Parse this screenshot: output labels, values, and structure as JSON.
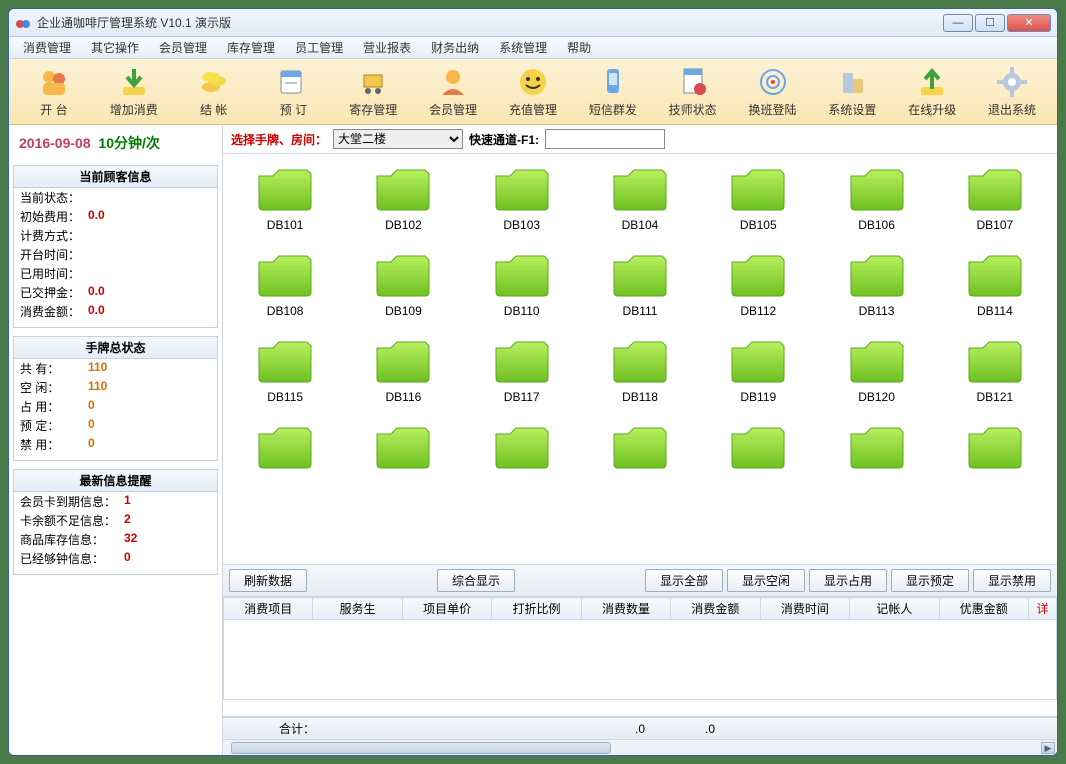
{
  "title": "企业通咖啡厅管理系统 V10.1  演示版",
  "menu": [
    "消费管理",
    "其它操作",
    "会员管理",
    "库存管理",
    "员工管理",
    "营业报表",
    "财务出纳",
    "系统管理",
    "帮助"
  ],
  "toolbar": [
    {
      "label": "开  台",
      "icon": "people"
    },
    {
      "label": "增加消费",
      "icon": "down"
    },
    {
      "label": "结  帐",
      "icon": "coins"
    },
    {
      "label": "预  订",
      "icon": "cal"
    },
    {
      "label": "寄存管理",
      "icon": "cart"
    },
    {
      "label": "会员管理",
      "icon": "member"
    },
    {
      "label": "充值管理",
      "icon": "smile"
    },
    {
      "label": "短信群发",
      "icon": "phone"
    },
    {
      "label": "技师状态",
      "icon": "doc"
    },
    {
      "label": "换班登陆",
      "icon": "target"
    },
    {
      "label": "系统设置",
      "icon": "build"
    },
    {
      "label": "在线升级",
      "icon": "up"
    },
    {
      "label": "退出系统",
      "icon": "gear"
    }
  ],
  "date": "2016-09-08",
  "rate": "10分钟/次",
  "filter": {
    "label": "选择手牌、房间：",
    "room": "大堂二楼",
    "fast_label": "快速通道-F1:",
    "fast_value": ""
  },
  "customer_panel": {
    "title": "当前顾客信息",
    "rows": [
      {
        "k": "当前状态：",
        "v": ""
      },
      {
        "k": "初始费用：",
        "v": "0.0",
        "cls": "vred"
      },
      {
        "k": "计费方式：",
        "v": ""
      },
      {
        "k": "开台时间：",
        "v": ""
      },
      {
        "k": "已用时间：",
        "v": ""
      },
      {
        "k": "已交押金：",
        "v": "0.0",
        "cls": "vred"
      },
      {
        "k": "消费金额：",
        "v": "0.0",
        "cls": "vred"
      }
    ]
  },
  "status_panel": {
    "title": "手牌总状态",
    "rows": [
      {
        "k": "共    有：",
        "v": "110",
        "cls": "vorange"
      },
      {
        "k": "空    闲：",
        "v": "110",
        "cls": "vorange"
      },
      {
        "k": "占    用：",
        "v": "0",
        "cls": "vorange"
      },
      {
        "k": "预    定：",
        "v": "0",
        "cls": "vorange"
      },
      {
        "k": "禁    用：",
        "v": "0",
        "cls": "vorange"
      }
    ]
  },
  "alert_panel": {
    "title": "最新信息提醒",
    "rows": [
      {
        "k": "会员卡到期信息：",
        "v": "1",
        "cls": "vred"
      },
      {
        "k": "卡余额不足信息：",
        "v": "2",
        "cls": "vred"
      },
      {
        "k": "商品库存信息：",
        "v": "32",
        "cls": "vred"
      },
      {
        "k": "已经够钟信息：",
        "v": "0",
        "cls": "vred"
      }
    ]
  },
  "folders": [
    "DB101",
    "DB102",
    "DB103",
    "DB104",
    "DB105",
    "DB106",
    "DB107",
    "DB108",
    "DB109",
    "DB110",
    "DB111",
    "DB112",
    "DB113",
    "DB114",
    "DB115",
    "DB116",
    "DB117",
    "DB118",
    "DB119",
    "DB120",
    "DB121",
    "",
    "",
    "",
    "",
    "",
    "",
    ""
  ],
  "action_buttons": [
    "刷新数据",
    "综合显示",
    "显示全部",
    "显示空闲",
    "显示占用",
    "显示预定",
    "显示禁用"
  ],
  "table_headers": [
    "消费项目",
    "服务生",
    "项目单价",
    "打折比例",
    "消费数量",
    "消费金额",
    "消费时间",
    "记帐人",
    "优惠金额",
    "详"
  ],
  "footer": {
    "label": "合计：",
    "v1": ".0",
    "v2": ".0"
  }
}
